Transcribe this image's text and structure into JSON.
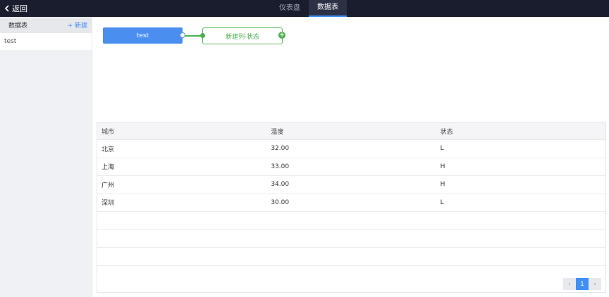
{
  "topbar": {
    "back_label": "返回",
    "tabs": [
      {
        "label": "仪表盘",
        "active": false
      },
      {
        "label": "数据表",
        "active": true
      }
    ]
  },
  "sidebar": {
    "title": "数据表",
    "new_label": "+ 新建",
    "items": [
      {
        "label": "test"
      }
    ]
  },
  "flow": {
    "source_label": "test",
    "target_label": "新建列·状态",
    "plus_symbol": "+"
  },
  "table": {
    "headers": [
      "城市",
      "温度",
      "状态"
    ],
    "rows": [
      [
        "北京",
        "32.00",
        "L"
      ],
      [
        "上海",
        "33.00",
        "H"
      ],
      [
        "广州",
        "34.00",
        "H"
      ],
      [
        "深圳",
        "30.00",
        "L"
      ]
    ],
    "empty_rows": 3
  },
  "pagination": {
    "prev": "‹",
    "current": "1",
    "next": "›"
  },
  "colors": {
    "accent": "#3f8ff5",
    "success": "#4caf50",
    "topbar": "#1a1d2d"
  }
}
